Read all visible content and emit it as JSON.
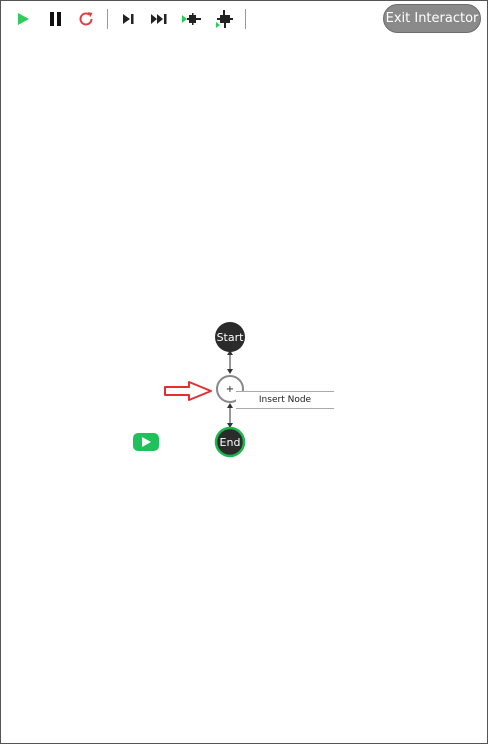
{
  "toolbar": {
    "buttons": [
      {
        "icon": "play-icon",
        "color": "#2ecc5a"
      },
      {
        "icon": "pause-icon",
        "color": "#111111"
      },
      {
        "icon": "restart-icon",
        "color": "#e04040"
      },
      {
        "icon": "step-icon",
        "color": "#222222"
      },
      {
        "icon": "fast-forward-icon",
        "color": "#222222"
      },
      {
        "icon": "run-to-node-icon",
        "color": "#222222"
      },
      {
        "icon": "debug-node-icon",
        "color": "#222222"
      }
    ],
    "exit_label": "Exit Interactor"
  },
  "flow": {
    "start_label": "Start",
    "add_node_label": "+",
    "end_label": "End",
    "insert_tooltip": "Insert Node",
    "colors": {
      "node_dark": "#2b2b2b",
      "end_ring": "#18b84a",
      "add_ring": "#888888",
      "arrow": "#e23030",
      "play_badge": "#1fc15a"
    }
  }
}
